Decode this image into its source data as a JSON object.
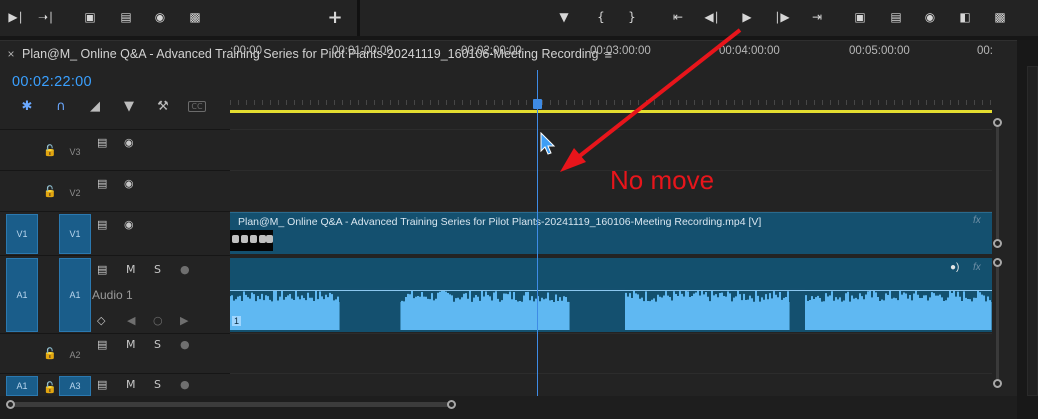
{
  "toolbar": {
    "left_icons": [
      "mark-in-icon",
      "go-to-out-icon",
      "lift-icon",
      "extract-icon",
      "export-frame-icon",
      "compare-icon"
    ],
    "add_label": "+",
    "center_icons": [
      "marker-icon",
      "mark-in-brace-icon",
      "mark-out-brace-icon",
      "go-to-in-icon",
      "step-back-icon",
      "play-icon",
      "step-forward-icon",
      "go-to-out-icon",
      "lift-icon",
      "extract-icon",
      "export-frame-icon",
      "multi-cam-icon",
      "compare-icon"
    ]
  },
  "sequence": {
    "close": "×",
    "title": "Plan@M_ Online Q&A - Advanced Training Series for Pilot Plants-20241119_160106-Meeting Recording",
    "menu": "≡"
  },
  "timecode": "00:02:22:00",
  "ruler_labels": [
    ":00:00",
    "00:01:00:00",
    "00:02:00:00",
    "00:03:00:00",
    "00:04:00:00",
    "00:05:00:00",
    "00:"
  ],
  "tracks": {
    "v3": {
      "target": "V3"
    },
    "v2": {
      "target": "V2"
    },
    "v1": {
      "source": "V1",
      "target": "V1"
    },
    "a1": {
      "source": "A1",
      "target": "A1",
      "name": "Audio 1",
      "mute": "M",
      "solo": "S"
    },
    "a2": {
      "target": "A2",
      "mute": "M",
      "solo": "S"
    },
    "a3": {
      "source": "A1",
      "target": "A3",
      "mute": "M",
      "solo": "S"
    }
  },
  "clips": {
    "video_title": "Plan@M_ Online Q&A - Advanced Training Series for Pilot Plants-20241119_160106-Meeting Recording.mp4 [V]",
    "fx_label": "fx",
    "audio_clip_number": "1"
  },
  "annotation": {
    "text": "No move",
    "color": "#e8151b"
  },
  "colors": {
    "timecode": "#3aa0ff",
    "work_area_bar": "#e4dd30",
    "playhead": "#3e8be6",
    "clip_video": "#14506f",
    "waveform": "#5fb8f2"
  }
}
